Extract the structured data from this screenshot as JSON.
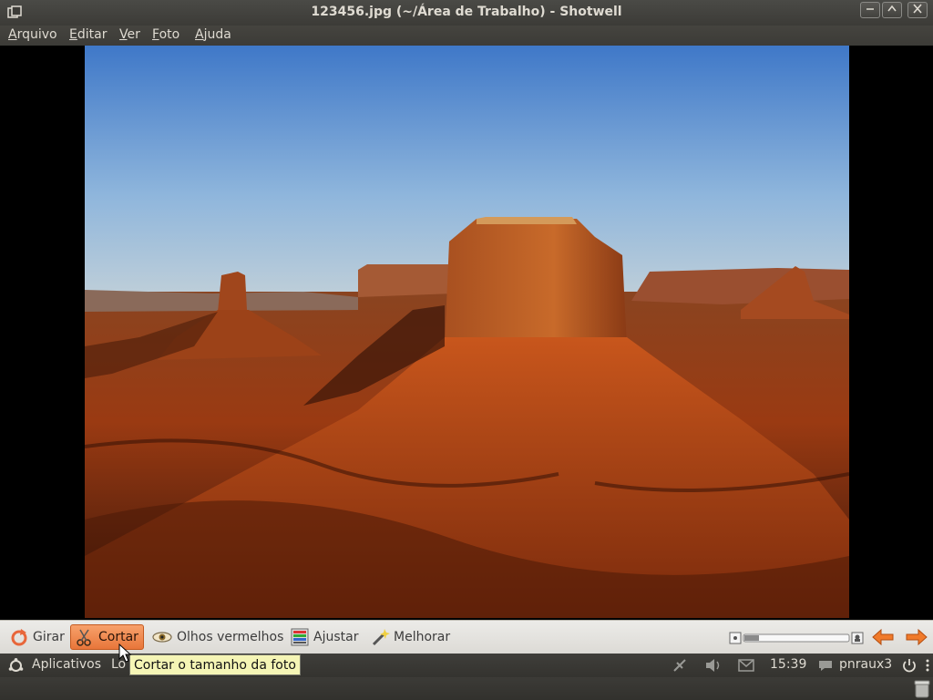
{
  "window": {
    "title": "123456.jpg (~/Área de Trabalho) - Shotwell"
  },
  "menubar": {
    "items": [
      {
        "label": "Arquivo",
        "u": "A",
        "rest": "rquivo"
      },
      {
        "label": "Editar",
        "u": "E",
        "rest": "ditar"
      },
      {
        "label": "Ver",
        "u": "V",
        "rest": "er"
      },
      {
        "label": "Foto",
        "u": "F",
        "rest": "oto"
      },
      {
        "label": "Ajuda",
        "u": "A",
        "rest": "juda"
      }
    ]
  },
  "photo": {
    "description_icon": "desert-butte-photo"
  },
  "toolbar": {
    "rotate_label": "Girar",
    "crop_label": "Cortar",
    "redeye_label": "Olhos vermelhos",
    "adjust_label": "Ajustar",
    "enhance_label": "Melhorar",
    "zoom_level": 0.0
  },
  "tooltip": {
    "text": "Cortar o tamanho da foto"
  },
  "panel": {
    "apps_label": "Aplicativos",
    "places_label_partial": "Lo",
    "clock": "15:39",
    "user": "pnraux3"
  },
  "colors": {
    "accent": "#e8763a",
    "arrow": "#f07a2a"
  }
}
